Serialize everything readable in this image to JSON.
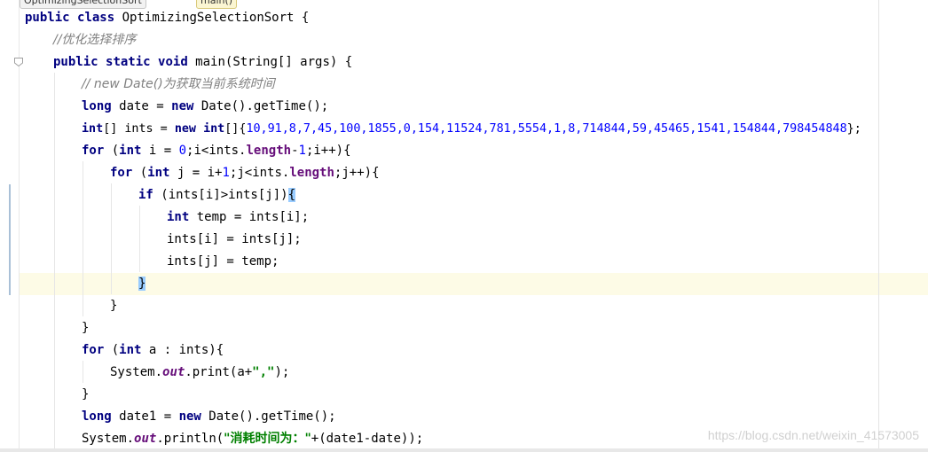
{
  "breadcrumb": {
    "class_name": "OptimizingSelectionSort",
    "method_name": "main()"
  },
  "code": {
    "l1": "public class OptimizingSelectionSort {",
    "l2": "//优化选择排序",
    "l3": "public static void main(String[] args) {",
    "l4": "// new Date()为获取当前系统时间",
    "l5": "long date = new Date().getTime();",
    "l6": "int[] ints = new int[]{10,91,8,7,45,100,1855,0,154,11524,781,5554,1,8,714844,59,45465,1541,154844,798454848};",
    "l7": "for (int i = 0;i<ints.length-1;i++){",
    "l8": "for (int j = i+1;j<ints.length;j++){",
    "l9": "if (ints[i]>ints[j]){",
    "l10": "int temp = ints[i];",
    "l11": "ints[i] = ints[j];",
    "l12": "ints[j] = temp;",
    "l13": "}",
    "l14": "}",
    "l15": "}",
    "l16": "for (int a : ints){",
    "l17": "System.out.print(a+\",\");",
    "l18": "}",
    "l19": "long date1 = new Date().getTime();",
    "l20": "System.out.println(\"消耗时间为：\"+(date1-date));"
  },
  "tokens": {
    "public": "public",
    "class": "class",
    "static": "static",
    "void": "void",
    "long": "long",
    "new": "new",
    "int": "int",
    "for": "for",
    "if": "if",
    "class_name": " OptimizingSelectionSort {",
    "comment1": "//优化选择排序",
    "comment2": "// new Date()为获取当前系统时间",
    "main_sig": " main(String[] args) {",
    "date_decl": " date = ",
    "date_call": " Date().getTime();",
    "ints_decl": "[] ints = ",
    "ints_open": "[]{",
    "ints_values": "10,91,8,7,45,100,1855,0,154,11524,781,5554,1,8,714844,59,45465,1541,154844,798454848",
    "ints_close": "};",
    "i_init": " i = ",
    "zero": "0",
    "i_cond": ";i<ints.",
    "length": "length",
    "minus": "-",
    "one": "1",
    "i_inc": ";i++){",
    "j_init": " j = i+",
    "j_cond": ";j<ints.",
    "j_inc": ";j++){",
    "if_cond": " (ints[i]>ints[j])",
    "open_brace": "{",
    "temp_decl": " temp = ints[i];",
    "swap1": "ints[i] = ints[j];",
    "swap2": "ints[j] = temp;",
    "close_brace": "}",
    "a_decl": " a : ints){",
    "system": "System.",
    "out": "out",
    "print_call": ".print(a+",
    "comma_str": "\",\"",
    "print_end": ");",
    "date1_decl": " date1 = ",
    "println_call": ".println(",
    "time_str": "\"消耗时间为：\"",
    "println_end": "+(date1-date));"
  },
  "watermark": "https://blog.csdn.net/weixin_41573005"
}
